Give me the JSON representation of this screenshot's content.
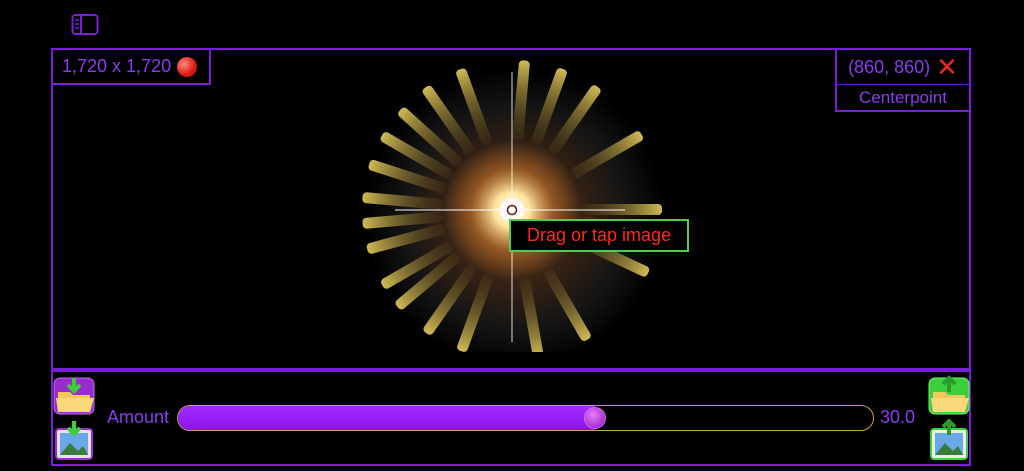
{
  "header": {
    "sidebar_icon": "sidebar-icon"
  },
  "image": {
    "size_text": "1,720 x 1,720",
    "size_icon": "red-dot-icon",
    "centerpoint_text": "(860, 860)",
    "centerpoint_clear_icon": "close-icon",
    "centerpoint_label": "Centerpoint",
    "hint_text": "Drag or tap image"
  },
  "controls": {
    "amount_label": "Amount",
    "amount_value": "30.0",
    "slider_fraction": 0.6,
    "left_icons": [
      "folder-download-icon",
      "photo-download-icon"
    ],
    "right_icons": [
      "folder-upload-icon",
      "photo-upload-icon"
    ]
  },
  "colors": {
    "accent": "#7a1fd6",
    "text": "#8a3cf0",
    "hint_border": "#4cd04c",
    "hint_text": "#ff2a1a",
    "slider_fill": "#9a1dff"
  }
}
